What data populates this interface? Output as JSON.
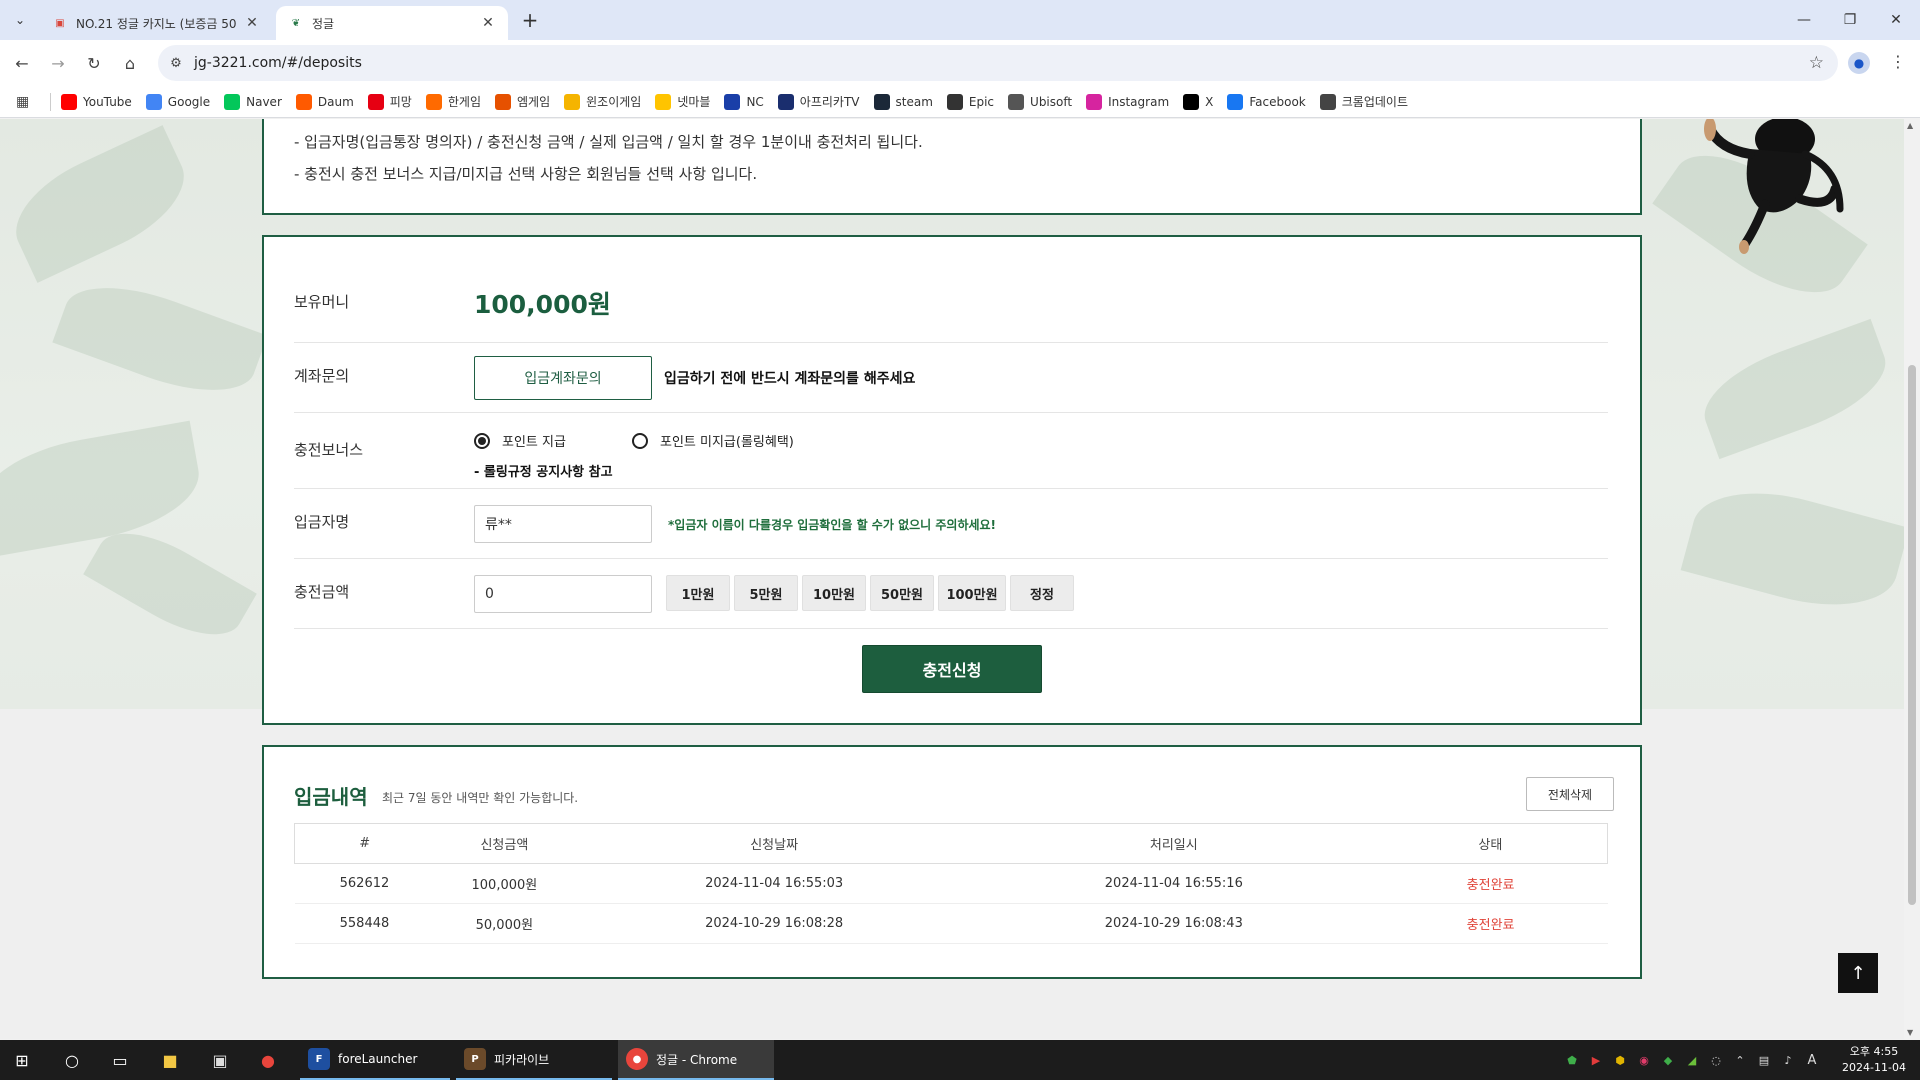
{
  "browser": {
    "tabs": [
      {
        "title": "NO.21 정글 카지노 (보증금 50",
        "active": false
      },
      {
        "title": "정글",
        "active": true
      }
    ],
    "url": "jg-3221.com/#/deposits",
    "bookmarks": [
      {
        "label": "YouTube",
        "icon": "youtube-icon",
        "color": "#ff0000"
      },
      {
        "label": "Google",
        "icon": "google-icon",
        "color": "#4285f4"
      },
      {
        "label": "Naver",
        "icon": "naver-icon",
        "color": "#03c75a"
      },
      {
        "label": "Daum",
        "icon": "daum-icon",
        "color": "#ff5a00"
      },
      {
        "label": "피망",
        "icon": "pmang-icon",
        "color": "#e60012"
      },
      {
        "label": "한게임",
        "icon": "hangame-icon",
        "color": "#ff6a00"
      },
      {
        "label": "엠게임",
        "icon": "mgame-icon",
        "color": "#e65100"
      },
      {
        "label": "윈조이게임",
        "icon": "winjoy-icon",
        "color": "#f5b400"
      },
      {
        "label": "넷마블",
        "icon": "netmarble-icon",
        "color": "#ffc400"
      },
      {
        "label": "NC",
        "icon": "nc-icon",
        "color": "#1a3fa8"
      },
      {
        "label": "아프리카TV",
        "icon": "afreecatv-icon",
        "color": "#1a2e6e"
      },
      {
        "label": "steam",
        "icon": "steam-icon",
        "color": "#1b2838"
      },
      {
        "label": "Epic",
        "icon": "epic-icon",
        "color": "#333333"
      },
      {
        "label": "Ubisoft",
        "icon": "ubisoft-icon",
        "color": "#555555"
      },
      {
        "label": "Instagram",
        "icon": "instagram-icon",
        "color": "#d6249f"
      },
      {
        "label": "X",
        "icon": "x-icon",
        "color": "#000000"
      },
      {
        "label": "Facebook",
        "icon": "facebook-icon",
        "color": "#1877f2"
      },
      {
        "label": "크롬업데이트",
        "icon": "gear-icon",
        "color": "#444444"
      }
    ]
  },
  "notice": {
    "line1": "- 입금자명(입금통장 명의자) / 충전신청 금액 / 실제 입금액 / 일치 할 경우 1분이내 충전처리 됩니다.",
    "line2": "- 충전시 충전 보너스 지급/미지급 선택 사항은 회원님들 선택 사항 입니다."
  },
  "form": {
    "balance_label": "보유머니",
    "balance_value": "100,000원",
    "account_label": "계좌문의",
    "account_button": "입금계좌문의",
    "account_hint": "입금하기 전에 반드시 계좌문의를 해주세요",
    "bonus_label": "충전보너스",
    "bonus_options": [
      "포인트 지급",
      "포인트 미지급(롤링혜택)"
    ],
    "bonus_selected": 0,
    "bonus_note": "- 롤링규정 공지사항 참고",
    "depositor_label": "입금자명",
    "depositor_value": "류**",
    "depositor_warning": "*입금자 이름이 다를경우 입금확인을 할 수가 없으니 주의하세요!",
    "amount_label": "충전금액",
    "amount_value": "0",
    "amount_buttons": [
      "1만원",
      "5만원",
      "10만원",
      "50만원",
      "100만원",
      "정정"
    ],
    "submit_label": "충전신청"
  },
  "history": {
    "title": "입금내역",
    "subtitle": "최근 7일 동안 내역만 확인 가능합니다.",
    "delete_all_label": "전체삭제",
    "columns": [
      "#",
      "신청금액",
      "신청날짜",
      "처리일시",
      "상태"
    ],
    "rows": [
      [
        "562612",
        "100,000원",
        "2024-11-04 16:55:03",
        "2024-11-04 16:55:16",
        "충전완료"
      ],
      [
        "558448",
        "50,000원",
        "2024-10-29 16:08:28",
        "2024-10-29 16:08:43",
        "충전완료"
      ]
    ]
  },
  "taskbar": {
    "apps": [
      {
        "label": "foreLauncher",
        "icon": "forelauncher-icon"
      },
      {
        "label": "피카라이브",
        "icon": "pikalive-icon"
      },
      {
        "label": "정글 - Chrome",
        "icon": "chrome-icon"
      }
    ],
    "clock_time": "오후 4:55",
    "clock_date": "2024-11-04"
  },
  "colors": {
    "brand_green": "#1d5e3e",
    "status_red": "#e0453a"
  }
}
